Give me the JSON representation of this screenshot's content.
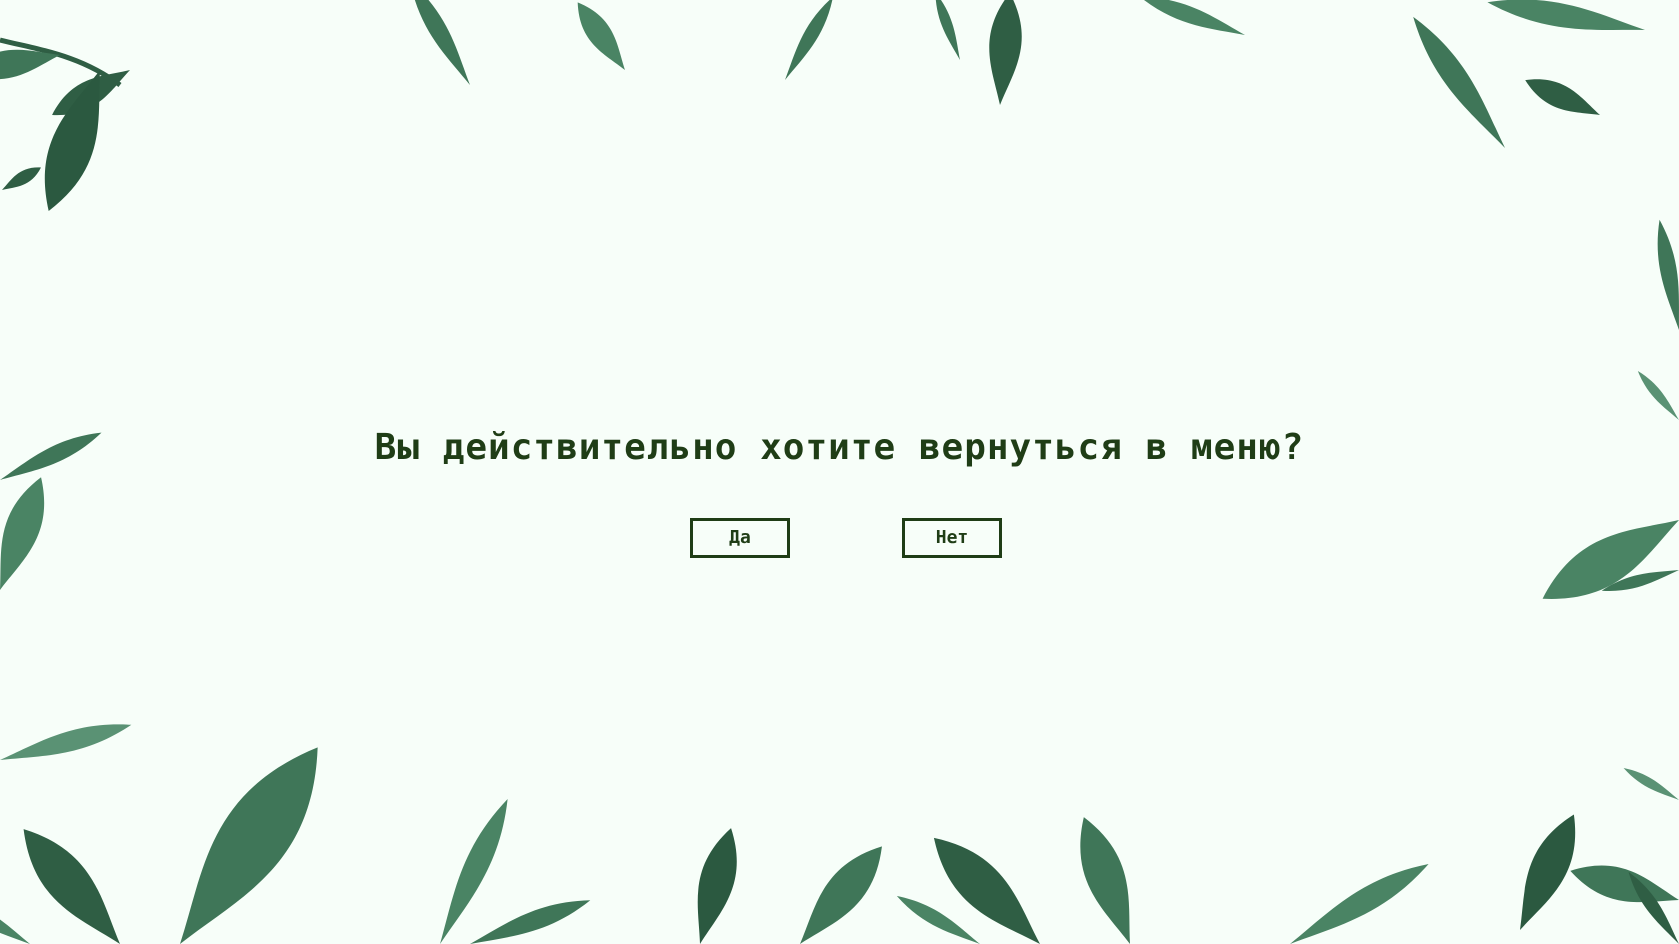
{
  "dialog": {
    "question": "Вы действительно хотите вернуться в меню?",
    "yes_label": "Да",
    "no_label": "Нет"
  },
  "colors": {
    "background": "#f7fef9",
    "text": "#1f3d16",
    "button_border": "#1f3d16",
    "leaf_dark": "#2f5e44",
    "leaf_mid": "#3f7658",
    "leaf_light": "#5a9274"
  },
  "decor": {
    "frame_icon": "watercolor-leaf-icon"
  }
}
